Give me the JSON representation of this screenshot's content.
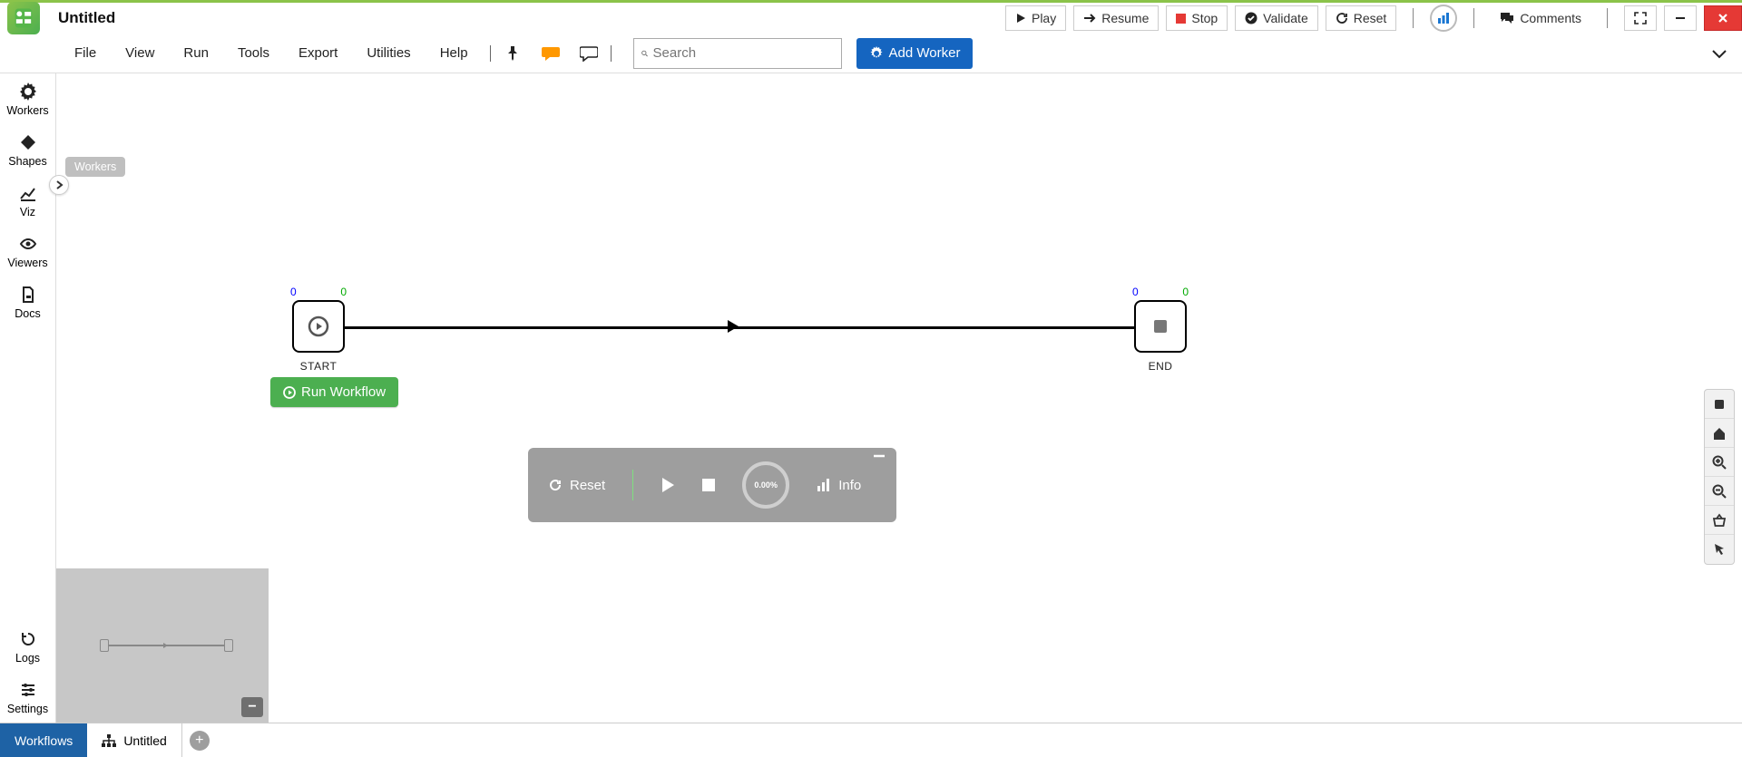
{
  "document": {
    "title": "Untitled"
  },
  "title_actions": {
    "play": "Play",
    "resume": "Resume",
    "stop": "Stop",
    "validate": "Validate",
    "reset": "Reset",
    "comments": "Comments"
  },
  "menu": {
    "items": [
      "File",
      "View",
      "Run",
      "Tools",
      "Export",
      "Utilities",
      "Help"
    ],
    "search_placeholder": "Search",
    "add_worker": "Add Worker"
  },
  "sidebar": {
    "items": [
      {
        "label": "Workers"
      },
      {
        "label": "Shapes"
      },
      {
        "label": "Viz"
      },
      {
        "label": "Viewers"
      },
      {
        "label": "Docs"
      }
    ],
    "logs": "Logs",
    "settings": "Settings",
    "tooltip": "Workers"
  },
  "canvas": {
    "start_label": "START",
    "end_label": "END",
    "run_workflow": "Run Workflow",
    "ports": {
      "blue": "0",
      "green": "0"
    }
  },
  "status_panel": {
    "reset": "Reset",
    "info": "Info",
    "progress": "0.00%"
  },
  "tabs": {
    "workflows": "Workflows",
    "untitled": "Untitled"
  }
}
